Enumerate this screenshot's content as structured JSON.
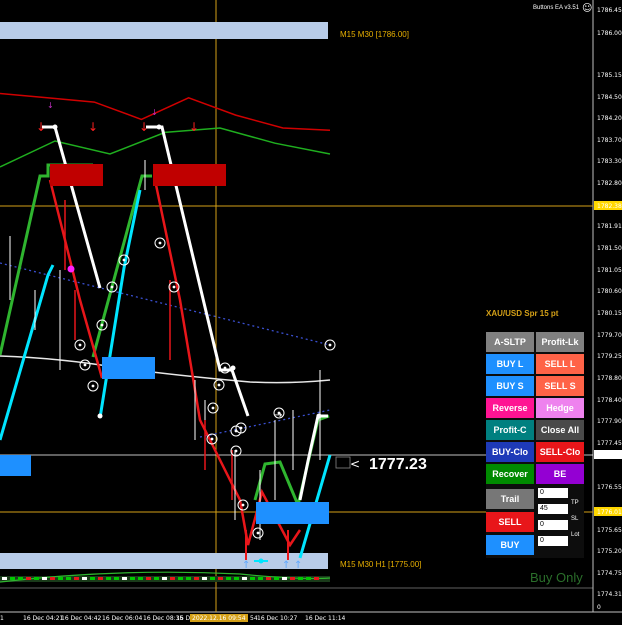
{
  "header": {
    "ea_label": "Buttons EA  v3.51",
    "smiley": "☺"
  },
  "symbol_label": "XAU/USD Spr 15 pt",
  "zones": {
    "upper": "M15 M30  [1786.00]",
    "lower": "M15 M30 H1  [1775.00]"
  },
  "price_marker": "1777.23",
  "ghost_text": "Buy Only",
  "price_axis": {
    "labels": [
      "1786.45",
      "1786.00",
      "1785.15",
      "1784.50",
      "1784.20",
      "1783.70",
      "1783.30",
      "1782.80",
      "1782.38",
      "1781.91",
      "1781.50",
      "1781.05",
      "1780.60",
      "1780.15",
      "1779.70",
      "1779.25",
      "1778.80",
      "1778.40",
      "1777.90",
      "1777.45",
      "1777.23",
      "1776.55",
      "1776.01",
      "1775.65",
      "1775.20",
      "1774.75",
      "1774.31",
      "0"
    ],
    "highlighted": {
      "1782.38": "#ffd700",
      "1777.23": "#ffffff",
      "1776.01": "#ffd700"
    }
  },
  "time_axis": {
    "labels": [
      "1",
      "16 Dec 04:21",
      "16 Dec 04:42",
      "16 Dec 06:04",
      "16 Dec 08:35",
      "16 Dec 09:06",
      "2022.12.16 09:54",
      "54",
      "16 Dec 10:27",
      "16 Dec 11:14"
    ]
  },
  "panel": {
    "rows": [
      {
        "left": "A-SLTP",
        "right": "Profit-Lk"
      },
      {
        "left": "BUY L",
        "right": "SELL L"
      },
      {
        "left": "BUY S",
        "right": "SELL S"
      },
      {
        "left": "Reverse",
        "right": "Hedge"
      },
      {
        "left": "Profit-C",
        "right": "Close All"
      },
      {
        "left": "BUY-Clo",
        "right": "SELL-Clo"
      },
      {
        "left": "Recover",
        "right": "BE"
      }
    ],
    "trail": "Trail",
    "sell": "SELL",
    "buy": "BUY",
    "trail_value": "0",
    "tp_value": "45",
    "tp_label": "TP",
    "sl_value": "0",
    "sl_label": "SL",
    "lot_value": "0",
    "lot_label": "Lot"
  },
  "colors": {
    "grey": "#808080",
    "blue": "#1e90ff",
    "coral": "#ff6347",
    "pink": "#ff1493",
    "violet": "#ee82ee",
    "teal": "#008080",
    "slate": "#4a4a4a",
    "royal": "#1e3ab8",
    "red": "#e8161a",
    "green": "#008a00",
    "purple": "#9400d3",
    "darkgrey": "#777777"
  },
  "chart_data": {
    "type": "line",
    "symbol": "XAU/USD",
    "current_price": 1777.23,
    "levels": [
      1782.38,
      1776.01
    ],
    "zones": [
      {
        "label": "M15 M30",
        "price": 1786.0
      },
      {
        "label": "M15 M30 H1",
        "price": 1775.0
      }
    ],
    "series": [
      {
        "color": "#ffffff",
        "values": [
          1783.95,
          1783.95,
          1779.6,
          1777.6,
          1779.0,
          1779.2,
          1777.1,
          1777.7,
          1777.0
        ]
      },
      {
        "color": "#e8161a",
        "values": [
          1782.9,
          1782.9,
          1779.3,
          1777.3,
          1776.1,
          1775.4,
          1775.7,
          1777.1
        ]
      },
      {
        "color": "#2fb52f",
        "values": [
          1778.0,
          1782.9,
          1782.0,
          1783.0,
          1782.6,
          1781.6,
          1776.6,
          1777.0,
          1776.0,
          1777.9
        ]
      },
      {
        "color": "#00e5ff",
        "values": [
          1777.9,
          1781.0,
          1778.6,
          1775.3
        ]
      },
      {
        "color": "#d00000",
        "values": [
          1784.6,
          1784.5,
          1784.4,
          1784.0,
          1784.5,
          1784.1,
          1783.8,
          1783.75
        ]
      },
      {
        "color": "#1fae1f",
        "values": [
          1782.9,
          1783.5,
          1783.2,
          1783.7,
          1783.8,
          1783.45,
          1783.2
        ]
      }
    ]
  }
}
